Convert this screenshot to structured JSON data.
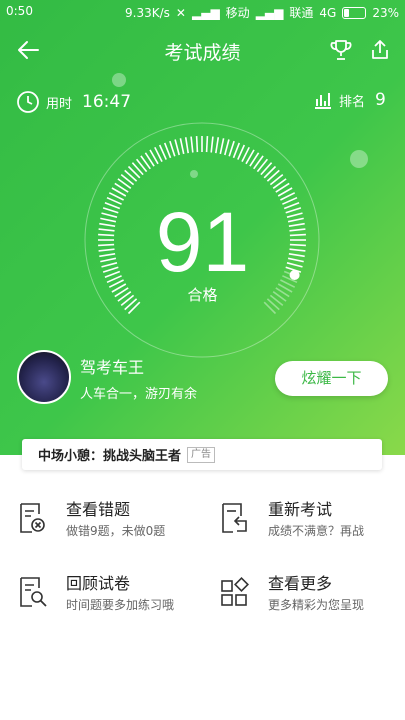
{
  "status_bar": {
    "time": "0:50",
    "speed": "9.33K/s",
    "carrier": "移动",
    "carrier2": "联通",
    "network": "4G",
    "battery": "23%"
  },
  "header": {
    "title": "考试成绩"
  },
  "stats": {
    "time_label": "用时",
    "time_value": "16:47",
    "rank_label": "排名",
    "rank_value": "9"
  },
  "result": {
    "score": "91",
    "verdict": "合格",
    "gauge_fraction": 0.91
  },
  "user": {
    "name": "驾考车王",
    "slogan": "人车合一，游刃有余",
    "share_button": "炫耀一下"
  },
  "ad": {
    "text": "中场小憩：挑战头脑王者",
    "tag": "广告"
  },
  "actions": [
    {
      "title": "查看错题",
      "subtitle": "做错9题，未做0题",
      "icon": "wrong-questions-icon"
    },
    {
      "title": "重新考试",
      "subtitle": "成绩不满意？再战",
      "icon": "retake-exam-icon"
    },
    {
      "title": "回顾试卷",
      "subtitle": "时间题要多加练习哦",
      "icon": "review-paper-icon"
    },
    {
      "title": "查看更多",
      "subtitle": "更多精彩为您呈现",
      "icon": "more-apps-icon"
    }
  ],
  "colors": {
    "primary": "#3cb846",
    "hero_end": "#8ad94a"
  }
}
